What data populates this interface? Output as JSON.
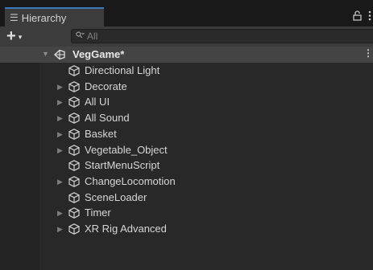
{
  "window": {
    "tab_title": "Hierarchy",
    "tab_icon": "list-icon",
    "lock_icon": "lock-icon",
    "more_icon": "vertical-dots-icon"
  },
  "toolbar": {
    "add_label": "+",
    "add_caret": "▾",
    "search_placeholder": "All",
    "search_icon": "search-icon"
  },
  "scene": {
    "name": "VegGame*",
    "icon": "unity-scene-icon",
    "expanded": true
  },
  "items": [
    {
      "label": "Directional Light",
      "has_children": false
    },
    {
      "label": "Decorate",
      "has_children": true
    },
    {
      "label": "All UI",
      "has_children": true
    },
    {
      "label": "All Sound",
      "has_children": true
    },
    {
      "label": "Basket",
      "has_children": true
    },
    {
      "label": "Vegetable_Object",
      "has_children": true
    },
    {
      "label": "StartMenuScript",
      "has_children": false
    },
    {
      "label": "ChangeLocomotion",
      "has_children": true
    },
    {
      "label": "SceneLoader",
      "has_children": false
    },
    {
      "label": "Timer",
      "has_children": true
    },
    {
      "label": "XR Rig Advanced",
      "has_children": true
    }
  ],
  "colors": {
    "background": "#282828",
    "tab_accent": "#3a79bb",
    "selected_row": "#444444",
    "text": "#d6d6d6"
  }
}
